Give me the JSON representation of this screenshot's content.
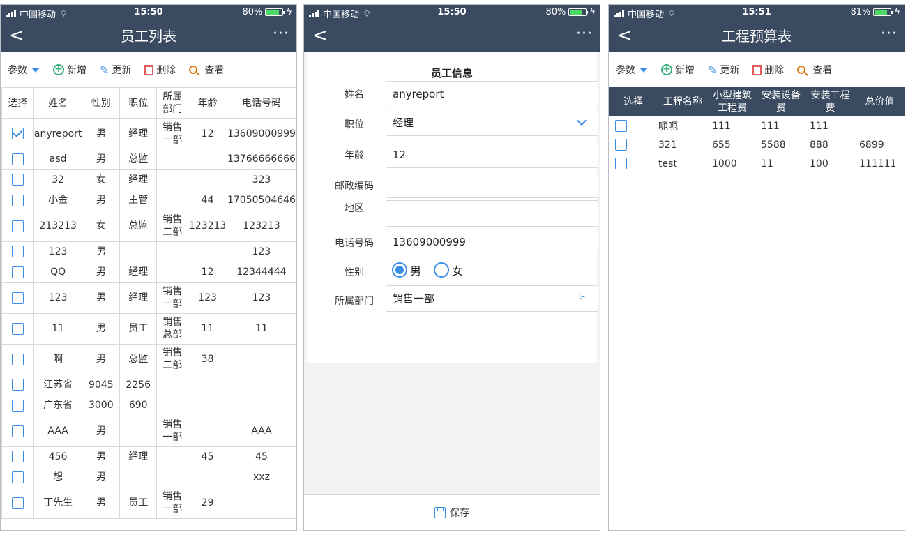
{
  "status": {
    "carrier": "中国移动",
    "screen1": {
      "time": "15:50",
      "battery": "80%",
      "battery_level": 0.8
    },
    "screen2": {
      "time": "15:50",
      "battery": "80%",
      "battery_level": 0.8
    },
    "screen3": {
      "time": "15:51",
      "battery": "81%",
      "battery_level": 0.81
    }
  },
  "nav": {
    "back": "<",
    "more": "···"
  },
  "toolbar": {
    "param": "参数",
    "add": "新增",
    "update": "更新",
    "delete": "删除",
    "view": "查看"
  },
  "employee_list": {
    "title": "员工列表",
    "columns": [
      "选择",
      "姓名",
      "性别",
      "职位",
      "所属部门",
      "年龄",
      "电话号码"
    ],
    "rows": [
      {
        "checked": true,
        "name": "anyreport",
        "gender": "男",
        "position": "经理",
        "dept": "销售一部",
        "age": "12",
        "phone": "13609000999"
      },
      {
        "checked": false,
        "name": "asd",
        "gender": "男",
        "position": "总监",
        "dept": "",
        "age": "",
        "phone": "13766666666"
      },
      {
        "checked": false,
        "name": "32",
        "gender": "女",
        "position": "经理",
        "dept": "",
        "age": "",
        "phone": "323"
      },
      {
        "checked": false,
        "name": "小金",
        "gender": "男",
        "position": "主管",
        "dept": "",
        "age": "44",
        "phone": "17050504646"
      },
      {
        "checked": false,
        "name": "213213",
        "gender": "女",
        "position": "总监",
        "dept": "销售二部",
        "age": "123213",
        "phone": "123213"
      },
      {
        "checked": false,
        "name": "123",
        "gender": "男",
        "position": "",
        "dept": "",
        "age": "",
        "phone": "123"
      },
      {
        "checked": false,
        "name": "QQ",
        "gender": "男",
        "position": "经理",
        "dept": "",
        "age": "12",
        "phone": "12344444"
      },
      {
        "checked": false,
        "name": "123",
        "gender": "男",
        "position": "经理",
        "dept": "销售一部",
        "age": "123",
        "phone": "123"
      },
      {
        "checked": false,
        "name": "11",
        "gender": "男",
        "position": "员工",
        "dept": "销售总部",
        "age": "11",
        "phone": "11"
      },
      {
        "checked": false,
        "name": "啊",
        "gender": "男",
        "position": "总监",
        "dept": "销售二部",
        "age": "38",
        "phone": ""
      },
      {
        "checked": false,
        "name": "江苏省",
        "gender": "9045",
        "position": "2256",
        "dept": "",
        "age": "",
        "phone": ""
      },
      {
        "checked": false,
        "name": "广东省",
        "gender": "3000",
        "position": "690",
        "dept": "",
        "age": "",
        "phone": ""
      },
      {
        "checked": false,
        "name": "AAA",
        "gender": "男",
        "position": "",
        "dept": "销售一部",
        "age": "",
        "phone": "AAA"
      },
      {
        "checked": false,
        "name": "456",
        "gender": "男",
        "position": "经理",
        "dept": "",
        "age": "45",
        "phone": "45"
      },
      {
        "checked": false,
        "name": "想",
        "gender": "男",
        "position": "",
        "dept": "",
        "age": "",
        "phone": "xxz"
      },
      {
        "checked": false,
        "name": "丁先生",
        "gender": "男",
        "position": "员工",
        "dept": "销售一部",
        "age": "29",
        "phone": ""
      }
    ]
  },
  "employee_form": {
    "heading": "员工信息",
    "fields": {
      "name": {
        "label": "姓名",
        "value": "anyreport"
      },
      "position": {
        "label": "职位",
        "value": "经理"
      },
      "age": {
        "label": "年龄",
        "value": "12"
      },
      "postcode": {
        "label": "邮政编码",
        "value": ""
      },
      "region": {
        "label": "地区",
        "value": ""
      },
      "phone": {
        "label": "电话号码",
        "value": "13609000999"
      },
      "gender": {
        "label": "性别",
        "options": [
          "男",
          "女"
        ],
        "selected": "男"
      },
      "dept": {
        "label": "所属部门",
        "value": "销售一部"
      }
    },
    "save": "保存"
  },
  "budget": {
    "title": "工程预算表",
    "columns": [
      "选择",
      "工程名称",
      "小型建筑工程费",
      "安装设备费",
      "安装工程费",
      "总价值"
    ],
    "rows": [
      {
        "name": "呃呃",
        "small": "111",
        "equip": "111",
        "install": "111",
        "total": ""
      },
      {
        "name": "321",
        "small": "655",
        "equip": "5588",
        "install": "888",
        "total": "6899"
      },
      {
        "name": "test",
        "small": "1000",
        "equip": "11",
        "install": "100",
        "total": "111111"
      }
    ]
  },
  "colors": {
    "navbar": "#3a4a61",
    "accent": "#3a8ee6",
    "add": "#3ab07c",
    "delete": "#e05b5b",
    "view": "#e07b1a"
  }
}
